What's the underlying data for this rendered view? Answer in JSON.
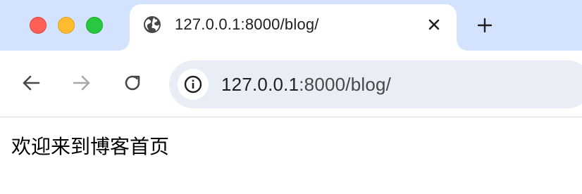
{
  "tab": {
    "title": "127.0.0.1:8000/blog/",
    "favicon": "globe-icon",
    "close_icon": "close-icon"
  },
  "new_tab_icon": "plus-icon",
  "navigation": {
    "back_icon": "arrow-left-icon",
    "forward_icon": "arrow-right-icon",
    "reload_icon": "reload-icon"
  },
  "address_bar": {
    "site_info_icon": "info-icon",
    "url_host": "127.0.0.1",
    "url_rest": ":8000/blog/"
  },
  "page": {
    "heading": "欢迎来到博客首页"
  },
  "colors": {
    "tabstrip_bg": "#d3e3fd",
    "omnibox_bg": "#e9eef6",
    "close_light": "#fe5f57",
    "minimize_light": "#febc2e",
    "maximize_light": "#28c840"
  }
}
